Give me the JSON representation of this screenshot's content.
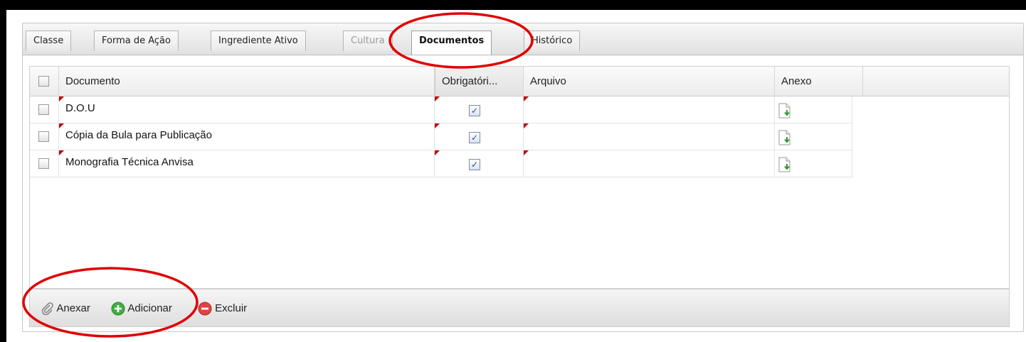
{
  "tabs": [
    {
      "label": "Classe",
      "state": "normal"
    },
    {
      "label": "Forma de Ação",
      "state": "normal"
    },
    {
      "label": "Ingrediente Ativo",
      "state": "normal"
    },
    {
      "label": "Cultura",
      "state": "disabled"
    },
    {
      "label": "Documentos",
      "state": "active"
    },
    {
      "label": "Histórico",
      "state": "normal"
    }
  ],
  "grid": {
    "columns": {
      "documento": "Documento",
      "obrigatorio": "Obrigatóri...",
      "arquivo": "Arquivo",
      "anexo": "Anexo"
    },
    "rows": [
      {
        "documento": "D.O.U",
        "obrigatorio": true,
        "arquivo": "",
        "anexo_icon": "document-download-icon"
      },
      {
        "documento": "Cópia da Bula para Publicação",
        "obrigatorio": true,
        "arquivo": "",
        "anexo_icon": "document-download-icon"
      },
      {
        "documento": "Monografia Técnica Anvisa",
        "obrigatorio": true,
        "arquivo": "",
        "anexo_icon": "document-download-icon"
      }
    ]
  },
  "toolbar": {
    "anexar": "Anexar",
    "adicionar": "Adicionar",
    "excluir": "Excluir"
  },
  "colors": {
    "annotation": "#e00000",
    "dirty_marker": "#c00000",
    "add_green": "#3aa63a",
    "delete_red": "#d83a3a"
  }
}
